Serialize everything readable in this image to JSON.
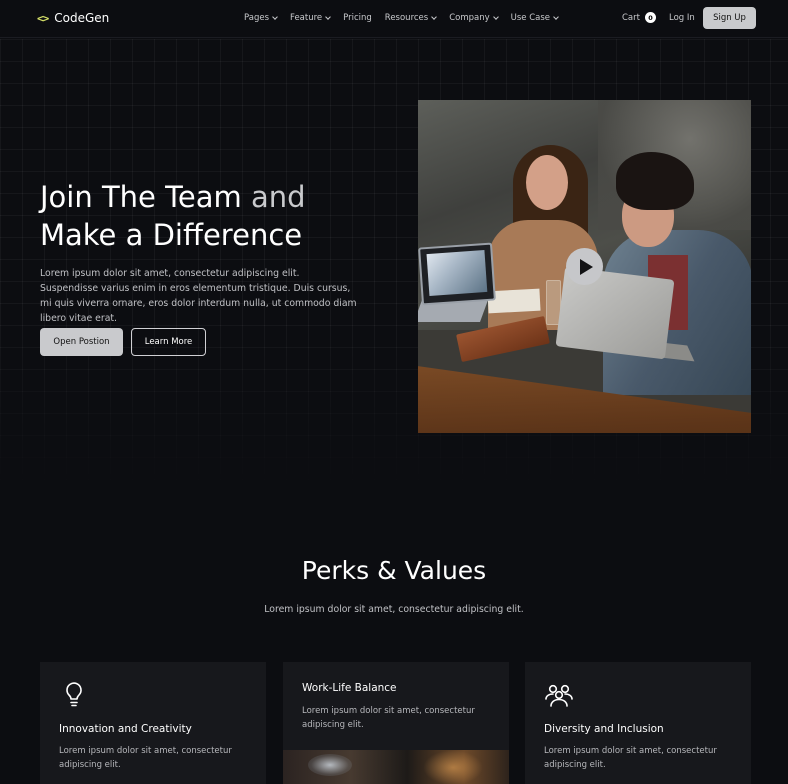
{
  "nav": {
    "logo_icon": "<>",
    "logo_text": "CodeGen",
    "menu": [
      {
        "label": "Pages",
        "has_dropdown": true
      },
      {
        "label": "Feature",
        "has_dropdown": true
      },
      {
        "label": "Pricing",
        "has_dropdown": false
      },
      {
        "label": "Resources",
        "has_dropdown": true
      },
      {
        "label": "Company",
        "has_dropdown": true
      },
      {
        "label": "Use Case",
        "has_dropdown": true
      }
    ],
    "cart_label": "Cart",
    "cart_count": "0",
    "login_label": "Log In",
    "signup_label": "Sign Up"
  },
  "hero": {
    "title_line1_a": "Join The Team",
    "title_line1_b": " and",
    "title_line2": "Make a Difference",
    "description": "Lorem ipsum dolor sit amet, consectetur adipiscing elit. Suspendisse varius enim in eros elementum tristique. Duis cursus, mi quis viverra ornare, eros dolor interdum nulla, ut commodo diam libero vitae erat.",
    "primary_button": "Open Postion",
    "secondary_button": "Learn More"
  },
  "perks": {
    "title": "Perks & Values",
    "subtitle": "Lorem ipsum dolor sit amet, consectetur adipiscing elit.",
    "cards": [
      {
        "icon": "lightbulb-icon",
        "title": "Innovation and Creativity",
        "description": "Lorem ipsum dolor sit amet, consectetur adipiscing elit."
      },
      {
        "icon": "none",
        "title": "Work-Life Balance",
        "description": "Lorem ipsum dolor sit amet, consectetur adipiscing elit."
      },
      {
        "icon": "group-icon",
        "title": "Diversity and Inclusion",
        "description": "Lorem ipsum dolor sit amet, consectetur adipiscing elit."
      }
    ]
  },
  "colors": {
    "background": "#0c0d11",
    "accent": "#d8e36a",
    "button_fill": "#c9cacd",
    "card_background": "#17181c"
  }
}
